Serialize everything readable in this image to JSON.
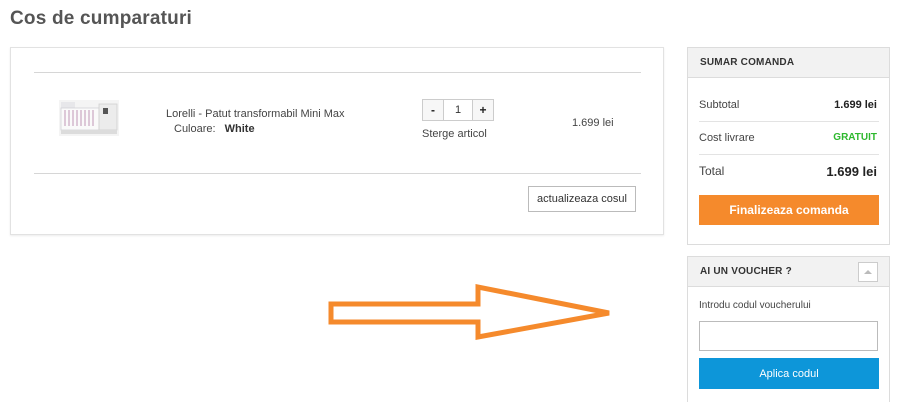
{
  "page": {
    "title": "Cos de cumparaturi"
  },
  "cart": {
    "item": {
      "name": "Lorelli - Patut transformabil Mini Max",
      "color_label": "Culoare:",
      "color_value": "White",
      "quantity": "1",
      "decrement_label": "-",
      "increment_label": "+",
      "remove_label": "Sterge articol",
      "price": "1.699 lei",
      "image_icon": "crib-product-image"
    },
    "update_label": "actualizeaza cosul"
  },
  "summary": {
    "header": "SUMAR COMANDA",
    "subtotal_label": "Subtotal",
    "subtotal_value": "1.699 lei",
    "shipping_label": "Cost livrare",
    "shipping_value": "GRATUIT",
    "total_label": "Total",
    "total_value": "1.699 lei",
    "checkout_label": "Finalizeaza comanda",
    "checkout_color": "#f58a2c",
    "free_color": "#2eb82e"
  },
  "voucher": {
    "header": "AI UN VOUCHER ?",
    "toggle_icon": "caret-up-icon",
    "input_label": "Introdu codul voucherului",
    "input_value": "",
    "apply_label": "Aplica codul",
    "apply_color": "#0d96d9"
  },
  "annotation": {
    "icon": "right-arrow-icon",
    "color": "#f58a2c"
  }
}
